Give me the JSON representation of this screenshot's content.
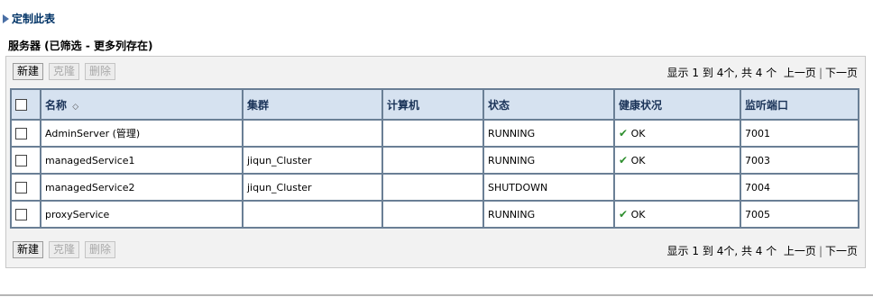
{
  "customize_link": "定制此表",
  "section_title": "服务器 (已筛选 - 更多列存在)",
  "buttons": {
    "new": "新建",
    "clone": "克隆",
    "delete": "删除"
  },
  "pager": {
    "display": "显示",
    "start": "1",
    "to": "到",
    "end": "4",
    "unit_comma": "个, 共",
    "total": "4",
    "unit": "个",
    "prev": "上一页",
    "next": "下一页"
  },
  "columns": [
    "名称",
    "集群",
    "计算机",
    "状态",
    "健康状况",
    "监听端口"
  ],
  "rows": [
    {
      "name": "AdminServer (管理)",
      "cluster": "",
      "machine": "",
      "state": "RUNNING",
      "health": "OK",
      "port": "7001"
    },
    {
      "name": "managedService1",
      "cluster": "jiqun_Cluster",
      "machine": "",
      "state": "RUNNING",
      "health": "OK",
      "port": "7003"
    },
    {
      "name": "managedService2",
      "cluster": "jiqun_Cluster",
      "machine": "",
      "state": "SHUTDOWN",
      "health": "",
      "port": "7004"
    },
    {
      "name": "proxyService",
      "cluster": "",
      "machine": "",
      "state": "RUNNING",
      "health": "OK",
      "port": "7005"
    }
  ]
}
